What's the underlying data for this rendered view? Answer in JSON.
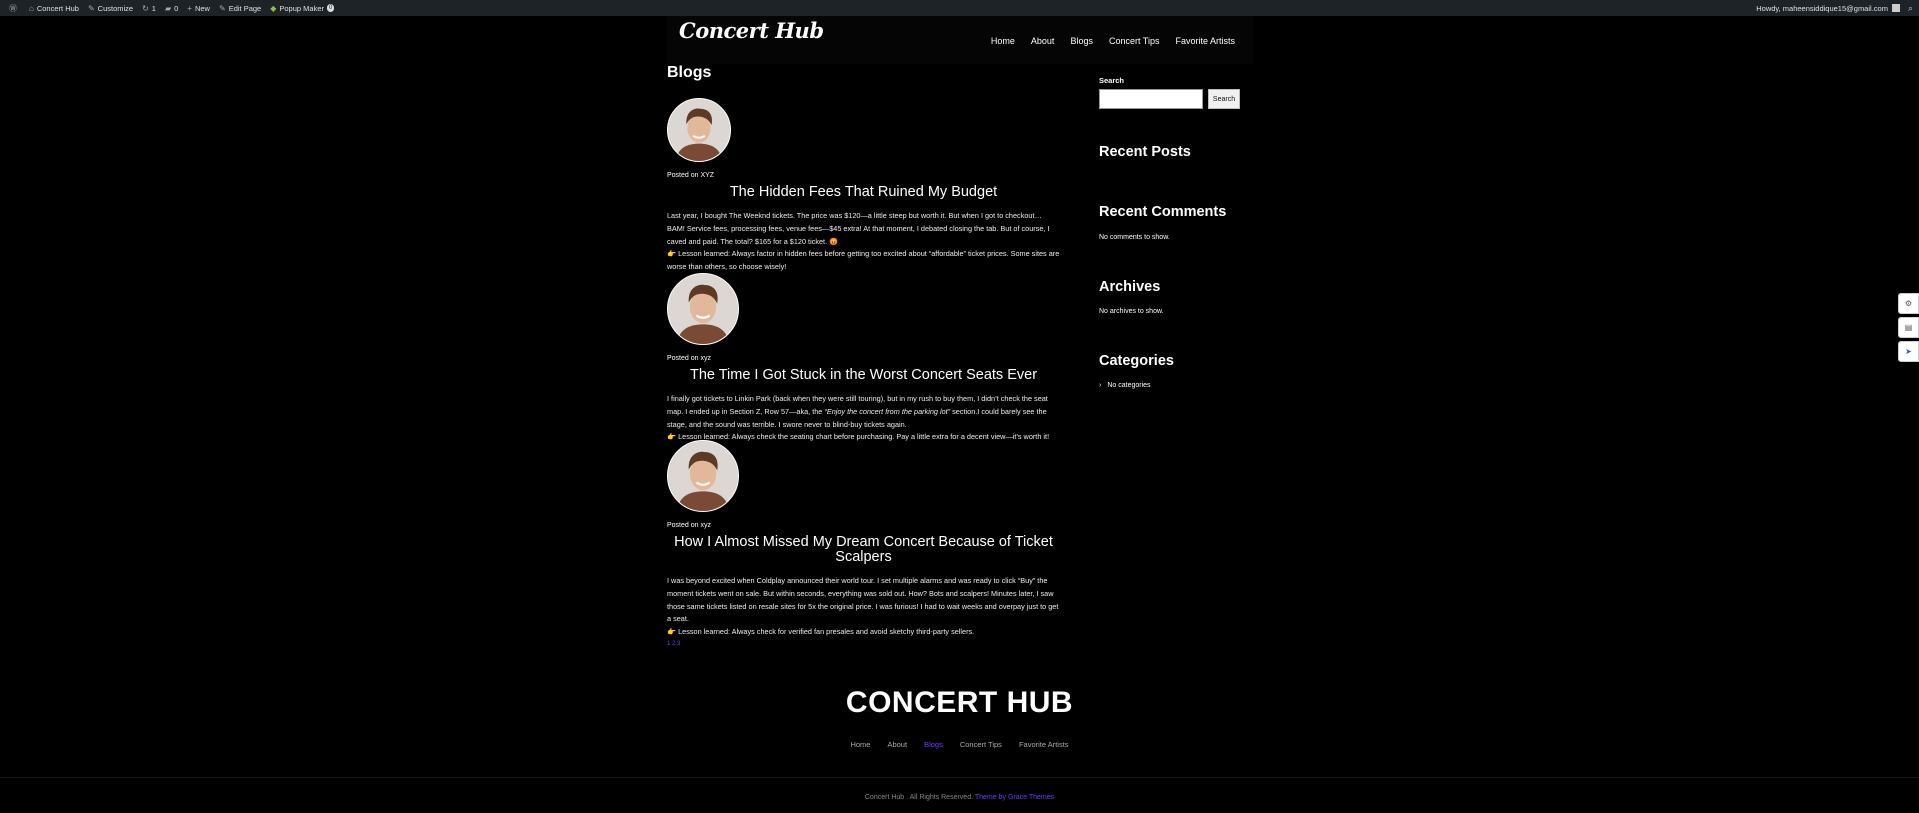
{
  "adminbar": {
    "site_name": "Concert Hub",
    "customize": "Customize",
    "updates_count": "1",
    "comments_count": "0",
    "new": "New",
    "edit_page": "Edit Page",
    "popup_maker": "Popup Maker",
    "popup_badge": "0",
    "howdy": "Howdy, maheensiddique15@gmail.com"
  },
  "header": {
    "logo": "Concert Hub",
    "nav": [
      "Home",
      "About",
      "Blogs",
      "Concert Tips",
      "Favorite Artists"
    ]
  },
  "page_title": "Blogs",
  "posts": [
    {
      "meta": "Posted on XYZ",
      "title": "The Hidden Fees That Ruined My Budget",
      "p1": "Last year, I bought The Weeknd tickets. The price was $120—a little steep but worth it. But when I got to checkout… BAM! Service fees, processing fees, venue fees—$45 extra! At that moment, I debated closing the tab. But of course, I caved and paid. The total? $165 for a $120 ticket. 😡",
      "p2": "👉 Lesson learned: Always factor in hidden fees before getting too excited about “affordable” ticket prices. Some sites are worse than others, so choose wisely!"
    },
    {
      "meta": "Posted on xyz",
      "title": "The Time I Got Stuck in the Worst Concert Seats Ever",
      "p1_a": "I finally got tickets to Linkin Park (back when they were still touring), but in my rush to buy them, I didn’t check the seat map. I ended up in Section Z, Row 57—aka, the ",
      "p1_em": "“Enjoy the concert from the parking lot”",
      "p1_b": " section.I could barely see the stage, and the sound was terrible. I swore never to blind-buy tickets again.",
      "p2": "👉 Lesson learned: Always check the seating chart before purchasing. Pay a little extra for a decent view—it’s worth it!"
    },
    {
      "meta": "Posted on xyz",
      "title": "How I Almost Missed My Dream Concert Because of Ticket Scalpers",
      "p1": "I was beyond excited when Coldplay announced their world tour. I set multiple alarms and was ready to click “Buy” the moment tickets went on sale. But within seconds, everything was sold out. How? Bots and scalpers! Minutes later, I saw those same tickets listed on resale sites for 5x the original price. I was furious! I had to wait weeks and overpay just to get a seat.",
      "p2": "👉 Lesson learned: Always check for verified fan presales and avoid sketchy third-party sellers.",
      "pagination": "1 2 3"
    }
  ],
  "sidebar": {
    "search_label": "Search",
    "search_button": "Search",
    "recent_posts": "Recent Posts",
    "recent_comments": "Recent Comments",
    "no_comments": "No comments to show.",
    "archives": "Archives",
    "no_archives": "No archives to show.",
    "categories": "Categories",
    "no_categories": "No categories"
  },
  "footer": {
    "logo": "CONCERT HUB",
    "nav": [
      "Home",
      "About",
      "Blogs",
      "Concert Tips",
      "Favorite Artists"
    ],
    "active_index": 2,
    "copyright": "Concert Hub . All Rights Reserved.",
    "credit": "Theme by Grace Themes"
  },
  "colors": {
    "accent": "#6a3cff",
    "background": "#000000",
    "adminbar": "#1d2327"
  }
}
